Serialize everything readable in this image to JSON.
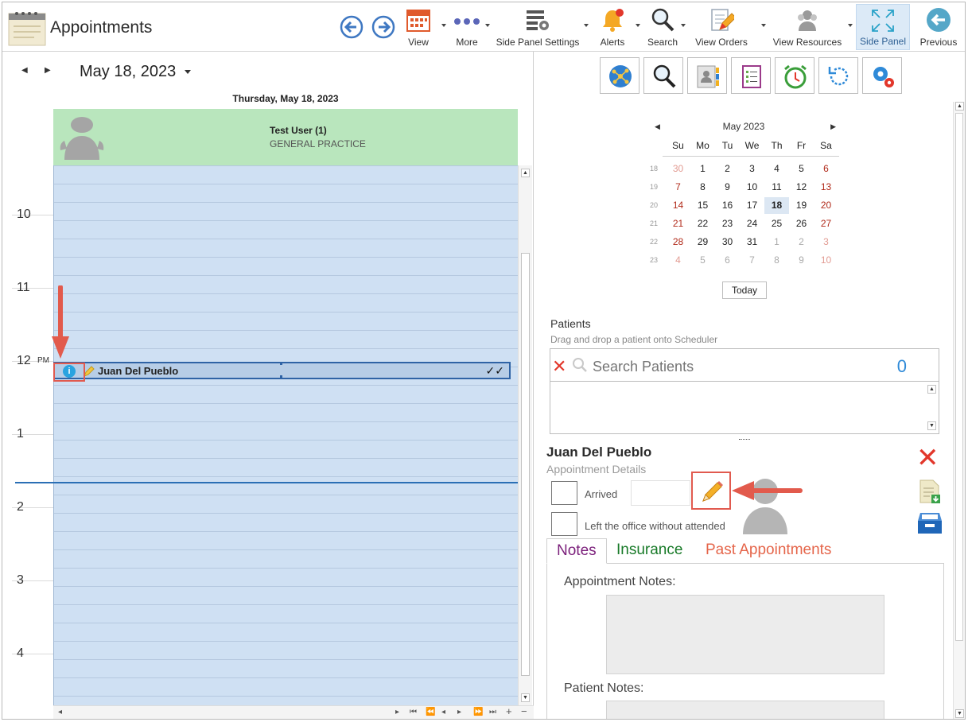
{
  "app": {
    "title": "Appointments"
  },
  "toolbar": {
    "view": "View",
    "more": "More",
    "side_panel_settings": "Side Panel Settings",
    "alerts": "Alerts",
    "search": "Search",
    "view_orders": "View Orders",
    "view_resources": "View Resources",
    "side_panel": "Side Panel",
    "previous": "Previous"
  },
  "scheduler": {
    "date": "May 18, 2023",
    "day_header": "Thursday, May 18, 2023",
    "resource_name": "Test User (1)",
    "resource_specialty": "GENERAL PRACTICE",
    "hours": [
      "10",
      "11",
      "12",
      "1",
      "2",
      "3",
      "4"
    ],
    "pm_label": "PM",
    "appointment": {
      "patient": "Juan Del Pueblo",
      "info": "i",
      "status": "✓✓"
    }
  },
  "calendar": {
    "month": "May 2023",
    "weekdays": [
      "Su",
      "Mo",
      "Tu",
      "We",
      "Th",
      "Fr",
      "Sa"
    ],
    "weeks": [
      {
        "wk": "18",
        "days": [
          "30",
          "1",
          "2",
          "3",
          "4",
          "5",
          "6"
        ]
      },
      {
        "wk": "19",
        "days": [
          "7",
          "8",
          "9",
          "10",
          "11",
          "12",
          "13"
        ]
      },
      {
        "wk": "20",
        "days": [
          "14",
          "15",
          "16",
          "17",
          "18",
          "19",
          "20"
        ]
      },
      {
        "wk": "21",
        "days": [
          "21",
          "22",
          "23",
          "24",
          "25",
          "26",
          "27"
        ]
      },
      {
        "wk": "22",
        "days": [
          "28",
          "29",
          "30",
          "31",
          "1",
          "2",
          "3"
        ]
      },
      {
        "wk": "23",
        "days": [
          "4",
          "5",
          "6",
          "7",
          "8",
          "9",
          "10"
        ]
      }
    ],
    "selected_day": "18",
    "today_label": "Today"
  },
  "patients": {
    "label": "Patients",
    "hint": "Drag and drop a patient onto Scheduler",
    "search_placeholder": "Search Patients",
    "count": "0"
  },
  "details": {
    "patient_name": "Juan Del Pueblo",
    "subtitle": "Appointment Details",
    "arrived_label": "Arrived",
    "left_label": "Left the office without attended"
  },
  "tabs": {
    "notes": "Notes",
    "insurance": "Insurance",
    "past": "Past Appointments"
  },
  "notes": {
    "appointment_label": "Appointment Notes:",
    "patient_label": "Patient Notes:"
  },
  "colors": {
    "accent_blue": "#2f63a5",
    "highlight_red": "#e15a4f",
    "resource_green": "#b9e6bd",
    "slot_blue": "#cfe0f3"
  }
}
